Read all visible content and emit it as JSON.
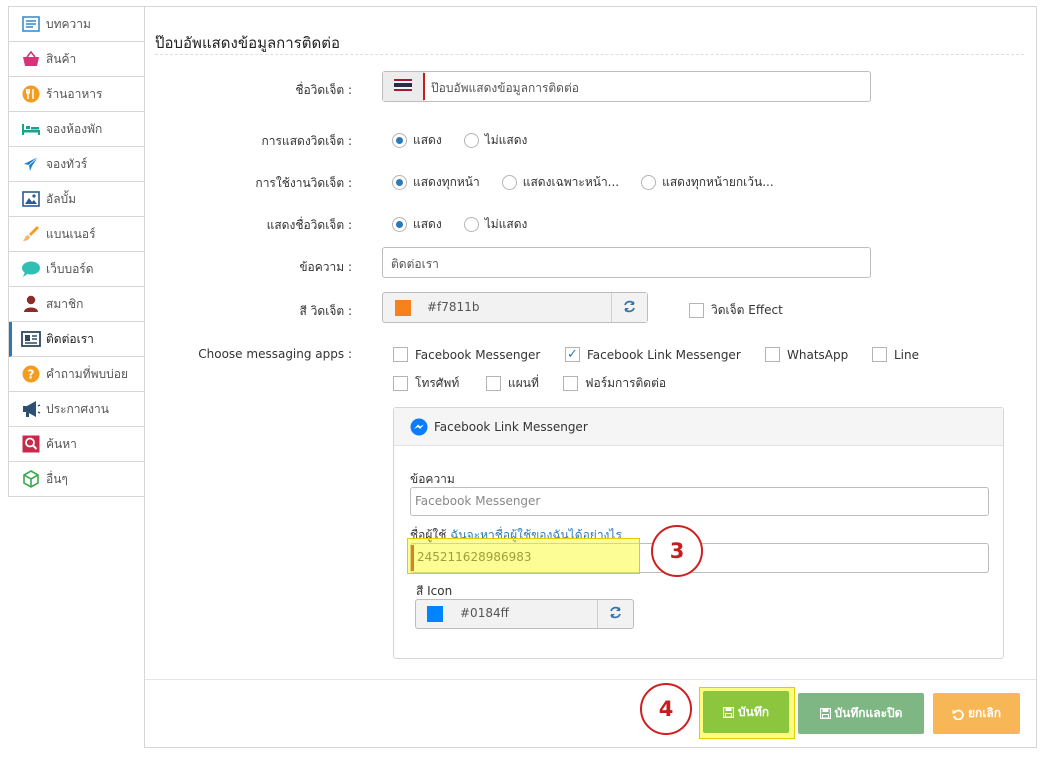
{
  "sidebar": {
    "items": [
      {
        "label": "บทความ",
        "icon": "article-icon"
      },
      {
        "label": "สินค้า",
        "icon": "shopping-basket-icon"
      },
      {
        "label": "ร้านอาหาร",
        "icon": "restaurant-icon"
      },
      {
        "label": "จองห้องพัก",
        "icon": "bed-icon"
      },
      {
        "label": "จองทัวร์",
        "icon": "airplane-icon"
      },
      {
        "label": "อัลบั้ม",
        "icon": "image-icon"
      },
      {
        "label": "แบนเนอร์",
        "icon": "brush-icon"
      },
      {
        "label": "เว็บบอร์ด",
        "icon": "chat-bubble-icon"
      },
      {
        "label": "สมาชิก",
        "icon": "user-icon"
      },
      {
        "label": "ติดต่อเรา",
        "icon": "contact-card-icon",
        "active": true
      },
      {
        "label": "คำถามที่พบบ่อย",
        "icon": "question-icon"
      },
      {
        "label": "ประกาศงาน",
        "icon": "megaphone-icon"
      },
      {
        "label": "ค้นหา",
        "icon": "search-icon"
      },
      {
        "label": "อื่นๆ",
        "icon": "cube-icon"
      }
    ]
  },
  "page": {
    "title": "ป๊อบอัพแสดงข้อมูลการติดต่อ"
  },
  "form": {
    "widget_name": {
      "label": "ชื่อวิดเจ็ต :",
      "value": "ป๊อบอัพแสดงข้อมูลการติดต่อ",
      "flag": "thai-flag-icon"
    },
    "widget_display": {
      "label": "การแสดงวิดเจ็ต :",
      "options": [
        "แสดง",
        "ไม่แสดง"
      ],
      "selected": 0
    },
    "widget_usage": {
      "label": "การใช้งานวิดเจ็ต :",
      "options": [
        "แสดงทุกหน้า",
        "แสดงเฉพาะหน้า...",
        "แสดงทุกหน้ายกเว้น..."
      ],
      "selected": 0
    },
    "widget_name_display": {
      "label": "แสดงชื่อวิดเจ็ต :",
      "options": [
        "แสดง",
        "ไม่แสดง"
      ],
      "selected": 0
    },
    "message": {
      "label": "ข้อความ :",
      "value": "ติดต่อเรา"
    },
    "widget_color": {
      "label": "สี วิดเจ็ต :",
      "value": "#f7811b",
      "color": "#f7811b"
    },
    "widget_effect": {
      "label": "วิดเจ็ต Effect",
      "checked": false
    },
    "messaging_apps": {
      "label": "Choose messaging apps :",
      "options": [
        {
          "label": "Facebook Messenger",
          "checked": false
        },
        {
          "label": "Facebook Link Messenger",
          "checked": true
        },
        {
          "label": "WhatsApp",
          "checked": false
        },
        {
          "label": "Line",
          "checked": false
        },
        {
          "label": "โทรศัพท์",
          "checked": false
        },
        {
          "label": "แผนที่",
          "checked": false
        },
        {
          "label": "ฟอร์มการติดต่อ",
          "checked": false
        }
      ]
    }
  },
  "fb_link": {
    "title": "Facebook Link Messenger",
    "message_label": "ข้อความ",
    "message_placeholder": "Facebook Messenger",
    "username_label": "ชื่อผู้ใช้",
    "username_help": "ฉันจะหาชื่อผู้ใช้ของฉันได้อย่างไร",
    "username_value": "245211628986983",
    "icon_color_label": "สี Icon",
    "icon_color_value": "#0184ff",
    "icon_color": "#0184ff"
  },
  "buttons": {
    "save": "บันทึก",
    "save_close": "บันทึกและปิด",
    "cancel": "ยกเลิก"
  },
  "annotations": {
    "step3": "3",
    "step4": "4"
  },
  "colors": {
    "save_button": "#8cc63f",
    "save_close_button": "#7fb784",
    "cancel_button": "#f7b757",
    "highlight": "#f7f71a",
    "callout": "#c81d1d",
    "accent": "#2a7ab8"
  }
}
